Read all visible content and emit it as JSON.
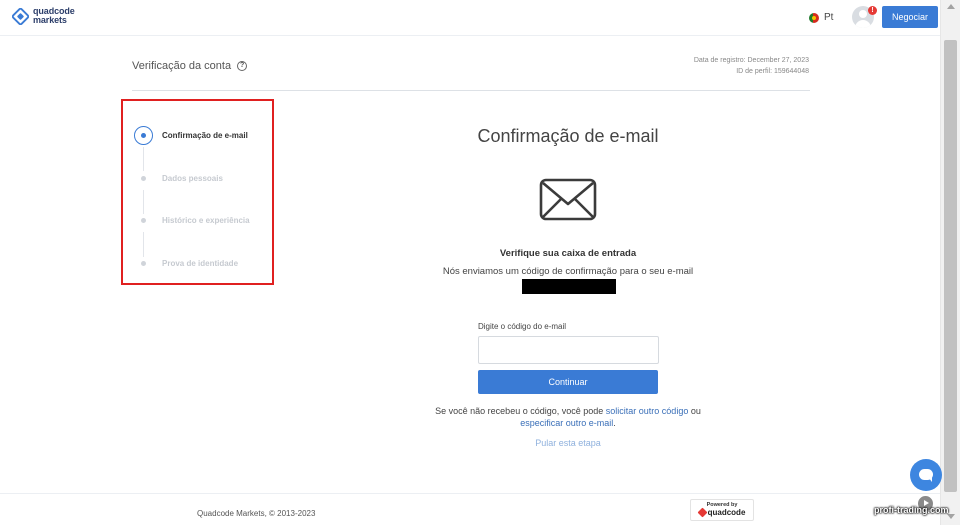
{
  "header": {
    "logo_line1": "quadcode",
    "logo_line2": "markets",
    "language": "Pt",
    "notification_count": "!",
    "trade_button": "Negociar"
  },
  "page": {
    "title": "Verificação da conta",
    "registration_date": "Data de registro: December 27, 2023",
    "profile_id": "ID de perfil: 159644048"
  },
  "steps": [
    {
      "label": "Confirmação de e-mail",
      "active": true
    },
    {
      "label": "Dados pessoais",
      "active": false
    },
    {
      "label": "Histórico e experiência",
      "active": false
    },
    {
      "label": "Prova de identidade",
      "active": false
    }
  ],
  "main": {
    "title": "Confirmação de e-mail",
    "icon": "envelope-icon",
    "check_inbox": "Verifique sua caixa de entrada",
    "sent_text": "Nós enviamos um código de confirmação para o seu e-mail",
    "code_label": "Digite o código do e-mail",
    "code_value": "",
    "continue_button": "Continuar",
    "resend_prefix": "Se você não recebeu o código, você pode",
    "resend_link": "solicitar outro código",
    "resend_or": "ou",
    "change_email_link": "especificar outro e-mail",
    "resend_suffix": ".",
    "skip": "Pular esta etapa"
  },
  "footer": {
    "copyright": "Quadcode Markets, © 2013-2023",
    "powered_by": "Powered by",
    "powered_brand": "quadcode"
  },
  "watermark": "profi-trading.com",
  "colors": {
    "accent": "#3a7bd5",
    "highlight_box": "#e02020",
    "link": "#3a6fb8"
  }
}
